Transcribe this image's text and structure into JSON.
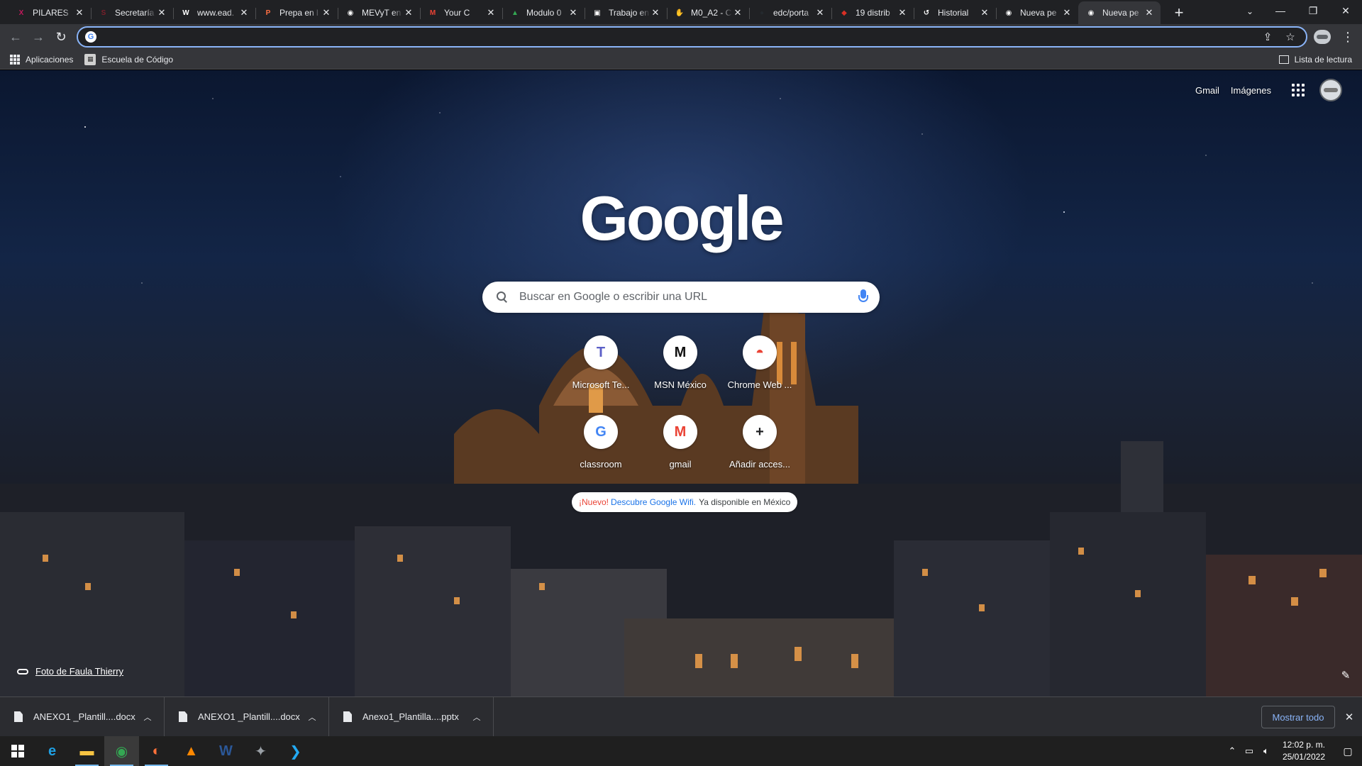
{
  "browser": {
    "tabs": [
      {
        "title": "PILARES",
        "favicon": "pilares-icon",
        "color": "#c2185b",
        "glyph": "X"
      },
      {
        "title": "Secretaría",
        "favicon": "secretaria-icon",
        "color": "#7b1f2b",
        "glyph": "S"
      },
      {
        "title": "www.ead.",
        "favicon": "wordpress-icon",
        "color": "#ffffff",
        "glyph": "W"
      },
      {
        "title": "Prepa en l",
        "favicon": "prepa-icon",
        "color": "#ff7043",
        "glyph": "P"
      },
      {
        "title": "MEVyT en",
        "favicon": "globe-icon",
        "color": "#ffffff",
        "glyph": "◉"
      },
      {
        "title": "Your C",
        "favicon": "gmail-icon",
        "color": "#ea4335",
        "glyph": "M"
      },
      {
        "title": "Modulo 0",
        "favicon": "drive-icon",
        "color": "#34a853",
        "glyph": "▲"
      },
      {
        "title": "Trabajo en",
        "favicon": "classroom-icon",
        "color": "#ffffff",
        "glyph": "▣"
      },
      {
        "title": "M0_A2 - C",
        "favicon": "hand-icon",
        "color": "#fbbc04",
        "glyph": "✋"
      },
      {
        "title": "edc/porta",
        "favicon": "github-icon",
        "color": "#24292e",
        "glyph": "●"
      },
      {
        "title": "19 distrib",
        "favicon": "distrib-icon",
        "color": "#d93025",
        "glyph": "◆"
      },
      {
        "title": "Historial",
        "favicon": "history-icon",
        "color": "#ffffff",
        "glyph": "↺"
      },
      {
        "title": "Nueva pe",
        "favicon": "chrome-icon",
        "color": "#ffffff",
        "glyph": "◉"
      },
      {
        "title": "Nueva pe",
        "favicon": "chrome-icon",
        "color": "#ffffff",
        "glyph": "◉",
        "active": true
      }
    ],
    "omnibox": {
      "value": "",
      "placeholder": ""
    },
    "bookmarks": [
      {
        "label": "Aplicaciones",
        "icon": "apps-grid-icon"
      },
      {
        "label": "Escuela de Código",
        "icon": "escuela-icon"
      }
    ],
    "reading_list": "Lista de lectura"
  },
  "ntp": {
    "links": {
      "gmail": "Gmail",
      "images": "Imágenes"
    },
    "logo": "Google",
    "search": {
      "placeholder": "Buscar en Google o escribir una URL"
    },
    "shortcuts": [
      {
        "label": "Microsoft Te...",
        "icon": "teams-icon",
        "glyph": "T",
        "color": "#5b5fc7"
      },
      {
        "label": "MSN México",
        "icon": "msn-icon",
        "glyph": "M",
        "color": "#111111"
      },
      {
        "label": "Chrome Web ...",
        "icon": "chrome-web-store-icon",
        "glyph": "◓",
        "color": "#ea4335"
      },
      {
        "label": "classroom",
        "icon": "google-g-icon",
        "glyph": "G",
        "color": "#4285f4"
      },
      {
        "label": "gmail",
        "icon": "gmail-icon",
        "glyph": "M",
        "color": "#ea4335"
      },
      {
        "label": "Añadir acces...",
        "icon": "plus-icon",
        "glyph": "+",
        "color": "#202124"
      }
    ],
    "promo": {
      "new": "¡Nuevo!",
      "link": "Descubre Google Wifi.",
      "rest": "Ya disponible en México"
    },
    "attribution": "Foto de Faula Thierry"
  },
  "downloads": {
    "items": [
      {
        "name": "ANEXO1 _Plantill....docx"
      },
      {
        "name": "ANEXO1 _Plantill....docx"
      },
      {
        "name": "Anexo1_Plantilla....pptx"
      }
    ],
    "show_all": "Mostrar todo"
  },
  "taskbar": {
    "apps": [
      {
        "name": "edge-icon",
        "glyph": "e",
        "color": "#1fa0e3",
        "running": false
      },
      {
        "name": "file-explorer-icon",
        "glyph": "▬",
        "color": "#f6c342",
        "running": true
      },
      {
        "name": "chrome-taskbar-icon",
        "glyph": "◉",
        "color": "#34a853",
        "running": true,
        "active": true
      },
      {
        "name": "firefox-icon",
        "glyph": "◐",
        "color": "#ff7139",
        "running": true
      },
      {
        "name": "vlc-icon",
        "glyph": "▲",
        "color": "#ff8800",
        "running": false
      },
      {
        "name": "word-icon",
        "glyph": "W",
        "color": "#2b5797",
        "running": false
      },
      {
        "name": "game-icon",
        "glyph": "✦",
        "color": "#9aa0a6",
        "running": false
      },
      {
        "name": "vscode-icon",
        "glyph": "❯",
        "color": "#23a9f2",
        "running": false
      }
    ],
    "time": "12:02 p. m.",
    "date": "25/01/2022"
  }
}
